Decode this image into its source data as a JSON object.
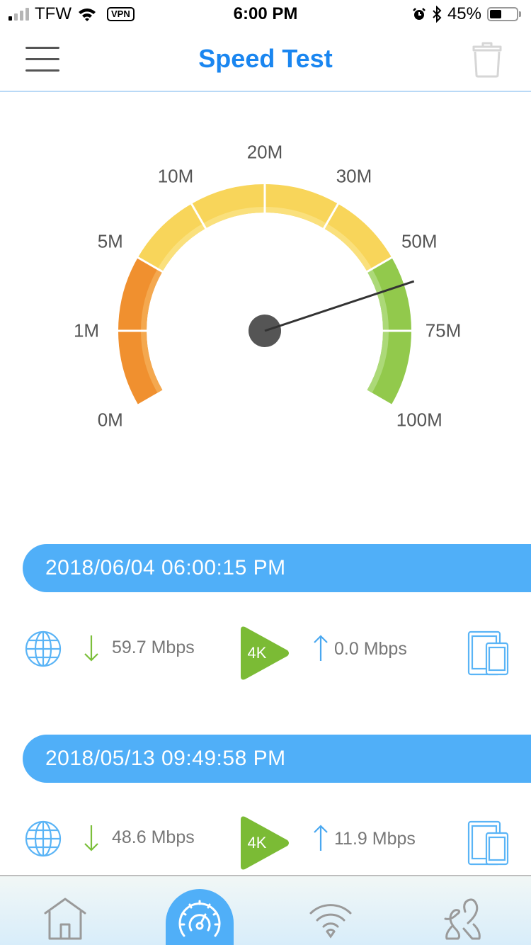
{
  "status_bar": {
    "carrier": "TFW",
    "vpn_label": "VPN",
    "time": "6:00 PM",
    "battery_percent_label": "45%",
    "battery_level": 0.45,
    "signal_bars_active": 1,
    "signal_bars_total": 4
  },
  "nav": {
    "title": "Speed Test",
    "menu_icon": "hamburger-menu-icon",
    "trash_icon": "trash-icon"
  },
  "gauge": {
    "current_value_mbps": 59.7,
    "ticks": [
      {
        "label": "0M",
        "value": 0
      },
      {
        "label": "1M",
        "value": 1
      },
      {
        "label": "5M",
        "value": 5
      },
      {
        "label": "10M",
        "value": 10
      },
      {
        "label": "20M",
        "value": 20
      },
      {
        "label": "30M",
        "value": 30
      },
      {
        "label": "50M",
        "value": 50
      },
      {
        "label": "75M",
        "value": 75
      },
      {
        "label": "100M",
        "value": 100
      }
    ],
    "segment_colors": [
      "#f0902f",
      "#f0902f",
      "#f8d55a",
      "#f8d55a",
      "#f8d55a",
      "#f8d55a",
      "#92c94c",
      "#92c94c"
    ],
    "segment_inner_colors": [
      "#f4a84f",
      "#f4a84f",
      "#fae07c",
      "#fae07c",
      "#fae07c",
      "#fae07c",
      "#acd978",
      "#acd978"
    ],
    "needle_color": "#333333",
    "hub_color": "#555555"
  },
  "results": [
    {
      "timestamp": "2018/06/04 06:00:15 PM",
      "download": "59.7 Mbps",
      "quality_badge": "4K",
      "upload": "0.0 Mbps"
    },
    {
      "timestamp": "2018/05/13 09:49:58 PM",
      "download": "48.6 Mbps",
      "quality_badge": "4K",
      "upload": "11.9 Mbps"
    }
  ],
  "colors": {
    "accent": "#1a86f0",
    "header_blue": "#50aff8",
    "download_green": "#7bbf3a",
    "badge_green": "#7bbb35",
    "upload_blue": "#4aa8f0",
    "icon_gray": "#9a9a9a"
  },
  "tab_bar": {
    "tabs": [
      {
        "name": "home",
        "icon": "home-icon",
        "active": false
      },
      {
        "name": "speed-test",
        "icon": "speedometer-icon",
        "active": true
      },
      {
        "name": "wifi",
        "icon": "wifi-icon",
        "active": false
      },
      {
        "name": "family",
        "icon": "family-icon",
        "active": false
      }
    ]
  }
}
